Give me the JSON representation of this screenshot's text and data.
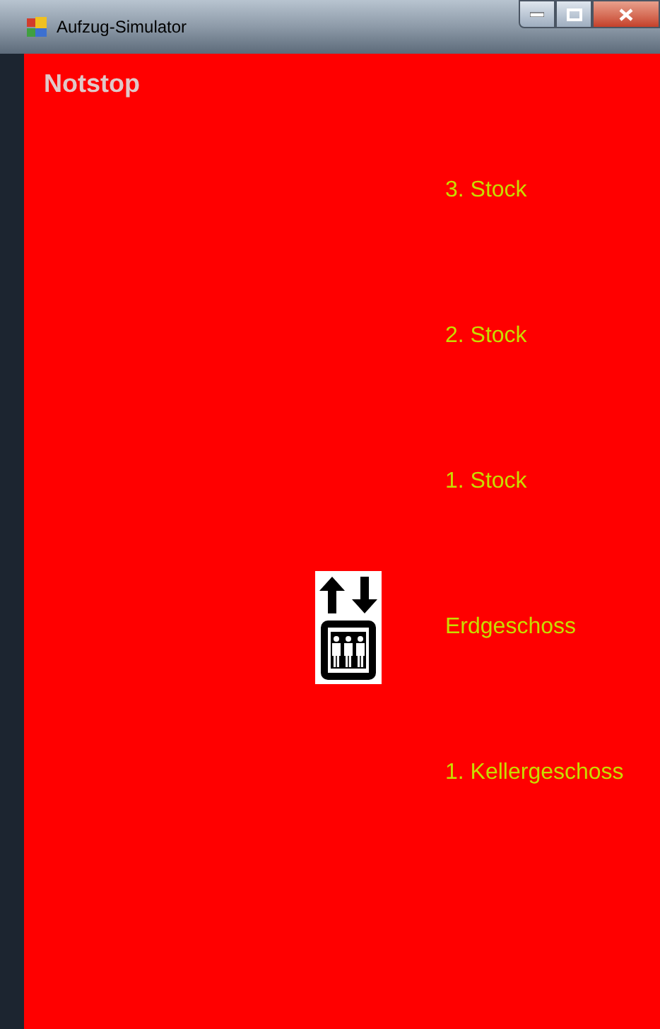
{
  "window": {
    "title": "Aufzug-Simulator"
  },
  "emergency_stop": {
    "label": "Notstop"
  },
  "floors": [
    {
      "label": "3. Stock",
      "selected": false
    },
    {
      "label": "2. Stock",
      "selected": false
    },
    {
      "label": "1. Stock",
      "selected": false
    },
    {
      "label": "Erdgeschoss",
      "selected": true
    },
    {
      "label": "1. Kellergeschoss",
      "selected": false
    }
  ]
}
